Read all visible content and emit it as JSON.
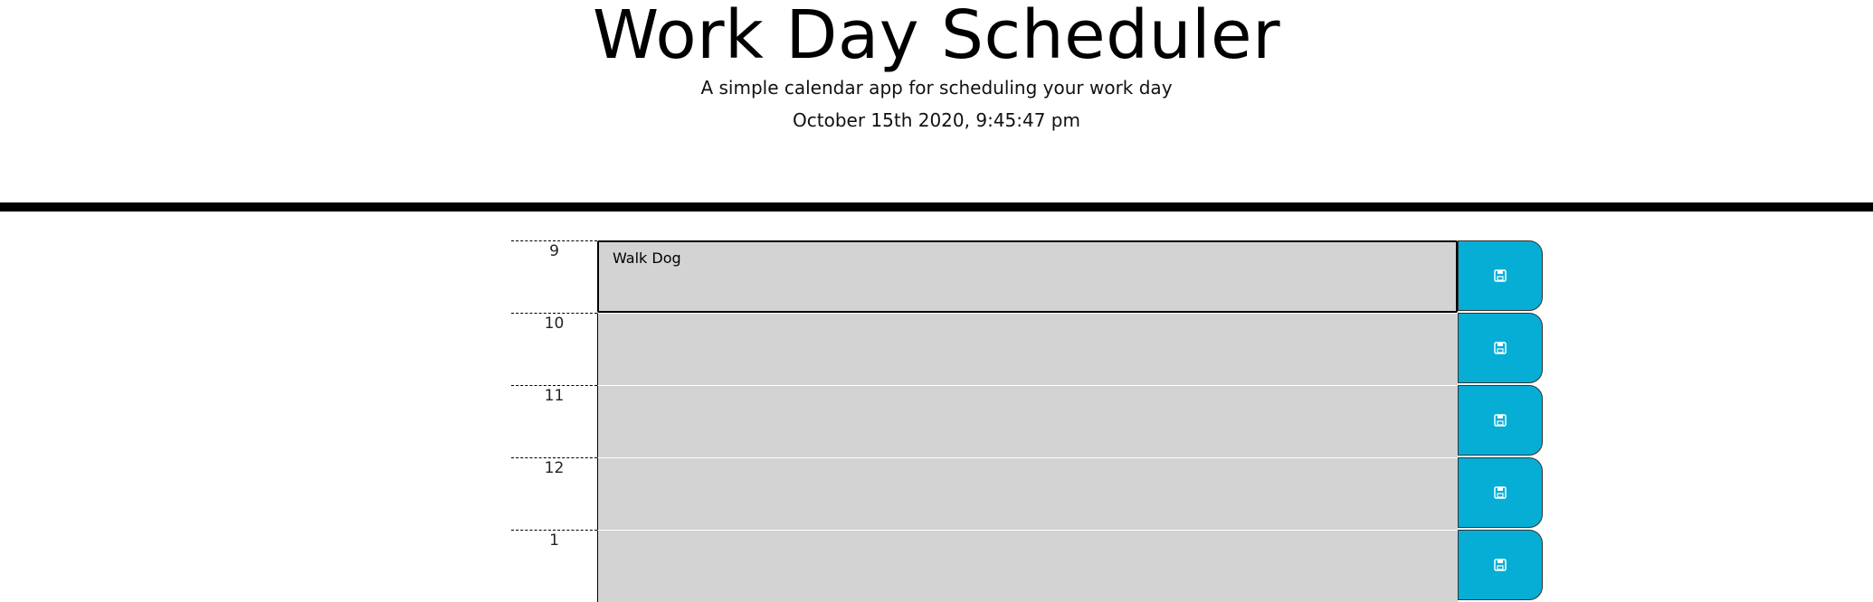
{
  "header": {
    "title": "Work Day Scheduler",
    "lead": "A simple calendar app for scheduling your work day",
    "current_day": "October 15th 2020, 9:45:47 pm"
  },
  "rows": [
    {
      "hour": "9",
      "text": "Walk Dog",
      "icon": "floppy-disk-icon"
    },
    {
      "hour": "10",
      "text": "",
      "icon": "floppy-disk-icon"
    },
    {
      "hour": "11",
      "text": "",
      "icon": "floppy-disk-icon"
    },
    {
      "hour": "12",
      "text": "",
      "icon": "floppy-disk-icon"
    },
    {
      "hour": "1",
      "text": "",
      "icon": "floppy-disk-icon"
    }
  ],
  "colors": {
    "past": "#d3d3d3",
    "save_button": "#06aed5",
    "header_rule": "#000000"
  }
}
